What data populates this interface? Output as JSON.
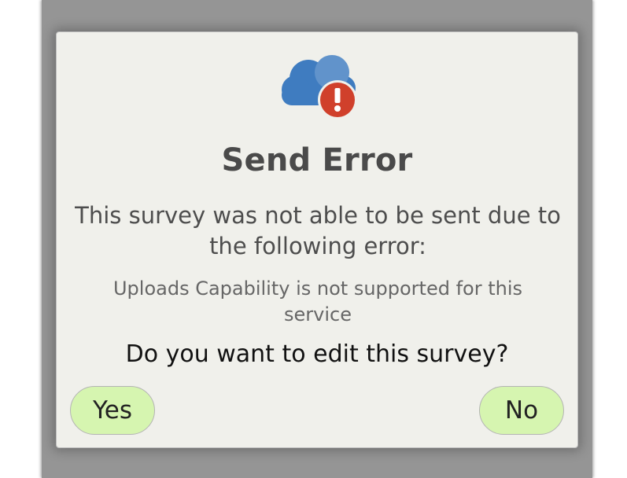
{
  "dialog": {
    "icon": "cloud-error-icon",
    "title": "Send Error",
    "message": "This survey was not able to be sent due to the following error:",
    "error_detail": "Uploads Capability is not supported for this service",
    "question": "Do you want to edit this survey?",
    "yes_label": "Yes",
    "no_label": "No"
  },
  "colors": {
    "backdrop": "#959595",
    "dialog_bg": "#f0f0eb",
    "cloud": "#3f7cc0",
    "error_badge": "#d0402b",
    "button_bg": "#d6f5b0"
  }
}
